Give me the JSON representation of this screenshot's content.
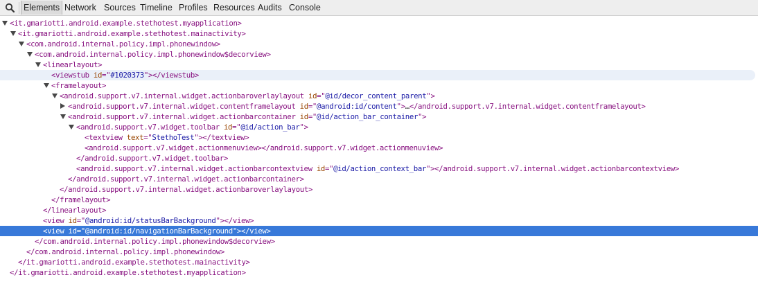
{
  "toolbar": {
    "search_icon": "magnifier-icon",
    "tabs": [
      "Elements",
      "Network",
      "Sources",
      "Timeline",
      "Profiles",
      "Resources",
      "Audits",
      "Console"
    ],
    "active_tab": "Elements"
  },
  "colors": {
    "tag": "#881280",
    "attr_name": "#994500",
    "attr_value": "#1a1aa6",
    "selection": "#3879d9",
    "hover": "#eaf0f9"
  },
  "dom_tree": {
    "rows": [
      {
        "tri": "down",
        "p": [
          [
            "tag",
            "<it.gmariotti.android.example.stethotest.myapplication>"
          ]
        ]
      },
      {
        "tri": "down",
        "p": [
          [
            "tag",
            "<it.gmariotti.android.example.stethotest.mainactivity>"
          ]
        ]
      },
      {
        "tri": "down",
        "p": [
          [
            "tag",
            "<com.android.internal.policy.impl.phonewindow>"
          ]
        ]
      },
      {
        "tri": "down",
        "p": [
          [
            "tag",
            "<com.android.internal.policy.impl.phonewindow$decorview>"
          ]
        ]
      },
      {
        "tri": "down",
        "p": [
          [
            "tag",
            "<linearlayout>"
          ]
        ]
      },
      {
        "tri": "",
        "state": "hover",
        "p": [
          [
            "tag",
            "<viewstub "
          ],
          [
            "an",
            "id"
          ],
          [
            "tag",
            "=\""
          ],
          [
            "av",
            "#1020373"
          ],
          [
            "tag",
            "\"></viewstub>"
          ]
        ]
      },
      {
        "tri": "down",
        "p": [
          [
            "tag",
            "<framelayout>"
          ]
        ]
      },
      {
        "tri": "down",
        "p": [
          [
            "tag",
            "<android.support.v7.internal.widget.actionbaroverlaylayout "
          ],
          [
            "an",
            "id"
          ],
          [
            "tag",
            "=\""
          ],
          [
            "av",
            "@id/decor_content_parent"
          ],
          [
            "tag",
            "\">"
          ]
        ]
      },
      {
        "tri": "right",
        "p": [
          [
            "tag",
            "<android.support.v7.internal.widget.contentframelayout "
          ],
          [
            "an",
            "id"
          ],
          [
            "tag",
            "=\""
          ],
          [
            "av",
            "@android:id/content"
          ],
          [
            "tag",
            "\">"
          ],
          [
            "tx",
            "…"
          ],
          [
            "tag",
            "</android.support.v7.internal.widget.contentframelayout>"
          ]
        ]
      },
      {
        "tri": "down",
        "p": [
          [
            "tag",
            "<android.support.v7.internal.widget.actionbarcontainer "
          ],
          [
            "an",
            "id"
          ],
          [
            "tag",
            "=\""
          ],
          [
            "av",
            "@id/action_bar_container"
          ],
          [
            "tag",
            "\">"
          ]
        ]
      },
      {
        "tri": "down",
        "p": [
          [
            "tag",
            "<android.support.v7.widget.toolbar "
          ],
          [
            "an",
            "id"
          ],
          [
            "tag",
            "=\""
          ],
          [
            "av",
            "@id/action_bar"
          ],
          [
            "tag",
            "\">"
          ]
        ]
      },
      {
        "tri": "",
        "p": [
          [
            "tag",
            "<textview "
          ],
          [
            "an",
            "text"
          ],
          [
            "tag",
            "=\""
          ],
          [
            "av",
            "StethoTest"
          ],
          [
            "tag",
            "\"></textview>"
          ]
        ]
      },
      {
        "tri": "",
        "p": [
          [
            "tag",
            "<android.support.v7.widget.actionmenuview></android.support.v7.widget.actionmenuview>"
          ]
        ]
      },
      {
        "tri": "",
        "p": [
          [
            "tag",
            "</android.support.v7.widget.toolbar>"
          ]
        ]
      },
      {
        "tri": "",
        "p": [
          [
            "tag",
            "<android.support.v7.internal.widget.actionbarcontextview "
          ],
          [
            "an",
            "id"
          ],
          [
            "tag",
            "=\""
          ],
          [
            "av",
            "@id/action_context_bar"
          ],
          [
            "tag",
            "\"></android.support.v7.internal.widget.actionbarcontextview>"
          ]
        ]
      },
      {
        "tri": "",
        "p": [
          [
            "tag",
            "</android.support.v7.internal.widget.actionbarcontainer>"
          ]
        ]
      },
      {
        "tri": "",
        "p": [
          [
            "tag",
            "</android.support.v7.internal.widget.actionbaroverlaylayout>"
          ]
        ]
      },
      {
        "tri": "",
        "p": [
          [
            "tag",
            "</framelayout>"
          ]
        ]
      },
      {
        "tri": "",
        "p": [
          [
            "tag",
            "</linearlayout>"
          ]
        ]
      },
      {
        "tri": "",
        "p": [
          [
            "tag",
            "<view "
          ],
          [
            "an",
            "id"
          ],
          [
            "tag",
            "=\""
          ],
          [
            "av",
            "@android:id/statusBarBackground"
          ],
          [
            "tag",
            "\"></view>"
          ]
        ]
      },
      {
        "tri": "",
        "state": "selected",
        "p": [
          [
            "tag",
            "<view "
          ],
          [
            "an",
            "id"
          ],
          [
            "tag",
            "=\""
          ],
          [
            "av",
            "@android:id/navigationBarBackground"
          ],
          [
            "tag",
            "\"></view>"
          ]
        ]
      },
      {
        "tri": "",
        "p": [
          [
            "tag",
            "</com.android.internal.policy.impl.phonewindow$decorview>"
          ]
        ]
      },
      {
        "tri": "",
        "p": [
          [
            "tag",
            "</com.android.internal.policy.impl.phonewindow>"
          ]
        ]
      },
      {
        "tri": "",
        "p": [
          [
            "tag",
            "</it.gmariotti.android.example.stethotest.mainactivity>"
          ]
        ]
      },
      {
        "tri": "",
        "p": [
          [
            "tag",
            "</it.gmariotti.android.example.stethotest.myapplication>"
          ]
        ]
      }
    ]
  }
}
